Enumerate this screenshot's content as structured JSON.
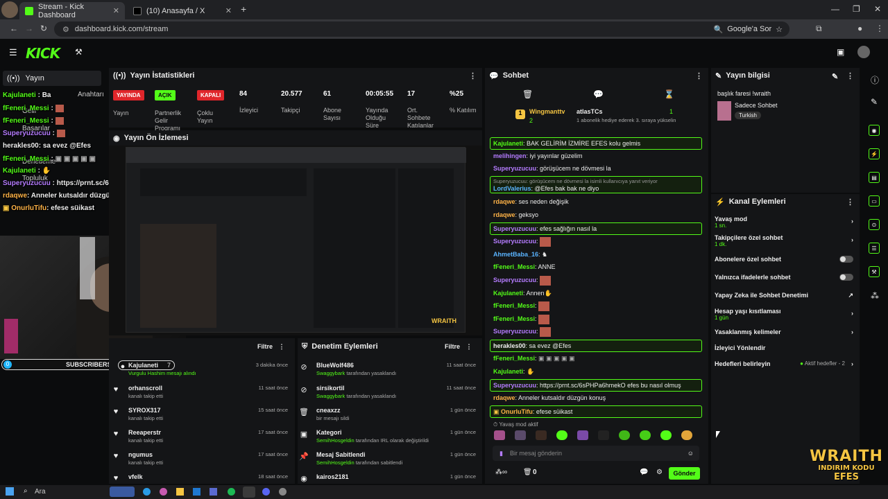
{
  "browser": {
    "tabs": [
      {
        "title": "Stream - Kick Dashboard",
        "active": true
      },
      {
        "title": "(10) Anasayfa / X",
        "active": false
      }
    ],
    "url": "dashboard.kick.com/stream",
    "google_label": "Google'a Sor"
  },
  "kick": {
    "logo": "KICK"
  },
  "sidebar": {
    "yayin": "Yayın",
    "gelir": "Gelir",
    "basarilar": "Başarılar",
    "denetleme": "Denetleme",
    "topluluk": "Topluluk",
    "anahtari": "Anahtarı"
  },
  "stats": {
    "title": "Yayın İstatistikleri",
    "badges": [
      {
        "label": "YAYINDA",
        "caption": "Yayın",
        "color": "#e0262b"
      },
      {
        "label": "AÇIK",
        "caption": "Partnerlik Gelir Programı",
        "color": "#53fc18"
      },
      {
        "label": "KAPALI",
        "caption": "Çoklu Yayın",
        "color": "#e0262b"
      }
    ],
    "items": [
      {
        "value": "84",
        "label": "İzleyici"
      },
      {
        "value": "20.577",
        "label": "Takipçi"
      },
      {
        "value": "61",
        "label": "Abone Sayısı"
      },
      {
        "value": "00:05:55",
        "label": "Yayında Olduğu Süre"
      },
      {
        "value": "17",
        "label": "Ort. Sohbete Katılanlar"
      },
      {
        "value": "%25",
        "label": "% Katılım"
      }
    ]
  },
  "preview": {
    "title": "Yayın Ön İzlemesi"
  },
  "activity": {
    "filter": "Filtre",
    "items": [
      {
        "name": "Kajulaneti",
        "sub": "Vurgulu Hashim mesajı alındı",
        "time": "3 dakika önce"
      },
      {
        "name": "orhanscroll",
        "sub": "kanalı takip etti",
        "time": "11 saat önce"
      },
      {
        "name": "SYROX317",
        "sub": "kanalı takip etti",
        "time": "15 saat önce"
      },
      {
        "name": "Reeaperstr",
        "sub": "kanalı takip etti",
        "time": "17 saat önce"
      },
      {
        "name": "ngumus",
        "sub": "kanalı takip etti",
        "time": "17 saat önce"
      },
      {
        "name": "vfelk",
        "sub": "",
        "time": "18 saat önce"
      }
    ]
  },
  "moderation": {
    "title": "Denetim Eylemleri",
    "filter": "Filtre",
    "items": [
      {
        "name": "BlueWolf486",
        "mod": "Swaggybark",
        "sub": "tarafından yasaklandı",
        "time": "11 saat önce",
        "icon": "⊘"
      },
      {
        "name": "sirsikortil",
        "mod": "Swaggybark",
        "sub": "tarafından yasaklandı",
        "time": "11 saat önce",
        "icon": "⊘"
      },
      {
        "name": "cneaxzz",
        "mod": "",
        "sub": "bir mesajı sildi",
        "time": "1 gün önce",
        "icon": "🗑"
      },
      {
        "name": "Kategori",
        "mod": "SemihHosgeldin",
        "sub": "tarafından IRL olarak değiştirildi",
        "time": "1 gün önce",
        "icon": "▣"
      },
      {
        "name": "Mesaj Sabitlendi",
        "mod": "SemihHosgeldin",
        "sub": "tarafından sabitlendi",
        "time": "1 gün önce",
        "icon": "📌"
      },
      {
        "name": "kairos2181",
        "mod": "",
        "sub": "",
        "time": "1 gün önce",
        "icon": "◉"
      }
    ]
  },
  "chat": {
    "title": "Sohbet",
    "pinned": {
      "user": "Wingmanttv",
      "other": "atlasTCs",
      "count": "2",
      "count2": "1",
      "text": "1 abonelik hediye ederek 3. sıraya yükselin"
    },
    "messages": [
      {
        "user": "Kajulaneti",
        "text": "BAK GELİRİM İZMİRE EFES kolu gelmis",
        "color": "#53fc18",
        "hl": true
      },
      {
        "user": "melihingen",
        "text": "iyi yayınlar güzelim",
        "color": "#b57cff",
        "hl": false
      },
      {
        "user": "Superyuzucuu",
        "text": "görüşücem ne dövmesi la",
        "color": "#b57cff",
        "hl": false
      },
      {
        "user": "LordValerius",
        "text": "@Efes bak bak ne diyo",
        "color": "#5ab4ff",
        "hl": true,
        "reply": "Superyuzucuu: görüşücem ne dövmesi la isimli kullanıcıya yanıt veriyor"
      },
      {
        "user": "rdaqwe",
        "text": "ses neden değişik",
        "color": "#ffb347",
        "hl": false
      },
      {
        "user": "rdaqwe",
        "text": "geksyo",
        "color": "#ffb347",
        "hl": false
      },
      {
        "user": "Superyuzucuu",
        "text": "efes sağlığın nasıl la",
        "color": "#b57cff",
        "hl": true
      },
      {
        "user": "Superyuzucuu",
        "text": "",
        "color": "#b57cff",
        "hl": false
      },
      {
        "user": "AhmetBaba_16",
        "text": "",
        "color": "#5ab4ff",
        "hl": false
      },
      {
        "user": "fFeneri_Messi",
        "text": "ANNE",
        "color": "#53fc18",
        "hl": false
      },
      {
        "user": "Superyuzucuu",
        "text": "",
        "color": "#b57cff",
        "hl": false
      },
      {
        "user": "Kajulaneti",
        "text": "Annen",
        "color": "#53fc18",
        "hl": false
      },
      {
        "user": "fFeneri_Messi",
        "text": "",
        "color": "#53fc18",
        "hl": false
      },
      {
        "user": "fFeneri_Messi",
        "text": "",
        "color": "#53fc18",
        "hl": false
      },
      {
        "user": "Superyuzucuu",
        "text": "",
        "color": "#b57cff",
        "hl": false
      },
      {
        "user": "herakles00",
        "text": "sa evez @Efes",
        "color": "#eeeeee",
        "hl": true
      },
      {
        "user": "fFeneri_Messi",
        "text": "",
        "color": "#53fc18",
        "hl": false
      },
      {
        "user": "Kajulaneti",
        "text": "",
        "color": "#53fc18",
        "hl": false
      },
      {
        "user": "Superyuzucuu",
        "text": "https://prnt.sc/6sPHPa6hmekO efes bu nasıl olmuş",
        "color": "#b57cff",
        "hl": true
      },
      {
        "user": "rdaqwe",
        "text": "Anneler kutsaldır düzgün konuş",
        "color": "#ffb347",
        "hl": false
      },
      {
        "user": "OnurluTifu",
        "text": "efese süikast",
        "color": "#ffb347",
        "hl": true
      }
    ],
    "slow_mode": "Yavaş mod aktif",
    "placeholder": "Bir mesaj gönderin",
    "send": "Gönder",
    "count": "0"
  },
  "info": {
    "title": "Yayın bilgisi",
    "stream_title": "başlık faresi !wraith",
    "category": "Sadece Sohbet",
    "tag": "Turkish"
  },
  "channel_actions": {
    "title": "Kanal Eylemleri",
    "items": [
      {
        "label": "Yavaş mod",
        "sub": "1 sn.",
        "ctrl": "arrow"
      },
      {
        "label": "Takipçilere özel sohbet",
        "sub": "1 dk.",
        "ctrl": "arrow"
      },
      {
        "label": "Abonelere özel sohbet",
        "sub": "",
        "ctrl": "toggle"
      },
      {
        "label": "Yalnızca ifadelerle sohbet",
        "sub": "",
        "ctrl": "toggle"
      },
      {
        "label": "Yapay Zeka ile Sohbet Denetimi",
        "sub": "",
        "ctrl": "ext"
      },
      {
        "label": "Hesap yaşı kısıtlaması",
        "sub": "1 gün",
        "ctrl": "arrow"
      },
      {
        "label": "Yasaklanmış kelimeler",
        "sub": "",
        "ctrl": "arrow"
      },
      {
        "label": "İzleyici Yönlendir",
        "sub": "",
        "ctrl": ""
      },
      {
        "label": "Hedefleri belirleyin",
        "sub": "",
        "ctrl": "goals",
        "extra": "Aktif hedefler - 2"
      }
    ]
  },
  "overlay": {
    "lines": [
      {
        "user": "Kajulaneti",
        "text": "Ba",
        "color": "#53fc18"
      },
      {
        "user": "fFeneri_Messi",
        "text": "",
        "color": "#53fc18"
      },
      {
        "user": "fFeneri_Messi",
        "text": "",
        "color": "#53fc18"
      },
      {
        "user": "Superyuzucuu",
        "text": "",
        "color": "#b57cff"
      },
      {
        "user": "herakles00",
        "text": "sa evez @Efes",
        "color": "#eeeeee"
      },
      {
        "user": "fFeneri_Messi",
        "text": "",
        "color": "#53fc18"
      },
      {
        "user": "Kajulaneti",
        "text": "",
        "color": "#53fc18"
      },
      {
        "user": "Superyuzucuu",
        "text": "https://prnt.sc/6sPHPa6hmekO efes bu nasıl olmuş",
        "color": "#b57cff"
      },
      {
        "user": "rdaqwe",
        "text": "Anneler kutsaldır düzgün konuş",
        "color": "#ffb347"
      },
      {
        "user": "OnurluTifu",
        "text": "efese süikast",
        "color": "#ffb347"
      }
    ],
    "subscribers_label": "SUBSCRIBERS",
    "subscribers_count": "0",
    "wraith": "WRAITH",
    "wraith_sub": "INDIRIM KODU",
    "wraith_code": "EFES"
  },
  "taskbar": {
    "search": "Ara"
  }
}
